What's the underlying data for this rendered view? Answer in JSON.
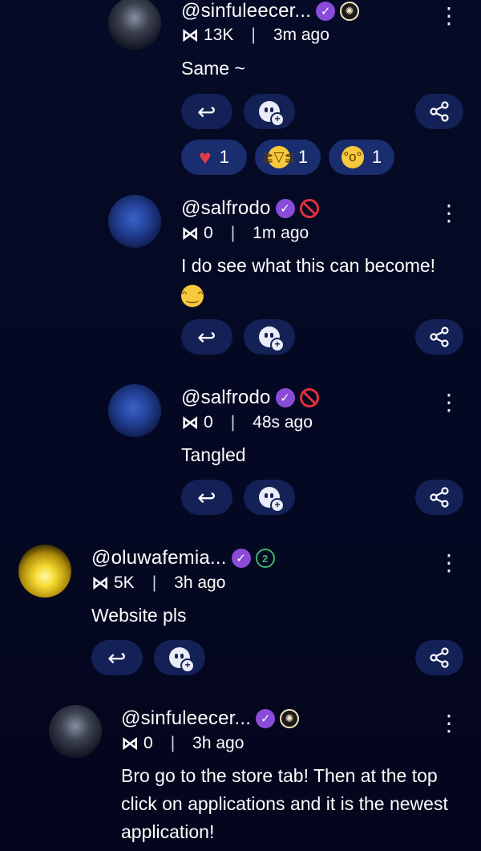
{
  "comments": [
    {
      "username": "@sinfuleecer...",
      "score": "13K",
      "time": "3m ago",
      "text": "Same ~",
      "reactions": [
        {
          "icon": "heart-emoji",
          "count": "1"
        },
        {
          "icon": "laughing-emoji",
          "count": "1"
        },
        {
          "icon": "surprised-emoji",
          "count": "1"
        }
      ]
    },
    {
      "username": "@salfrodo",
      "score": "0",
      "time": "1m ago",
      "text": "I do see what this can become!"
    },
    {
      "username": "@salfrodo",
      "score": "0",
      "time": "48s ago",
      "text": "Tangled"
    },
    {
      "username": "@oluwafemia...",
      "score": "5K",
      "time": "3h ago",
      "text": "Website pls",
      "level": "2"
    },
    {
      "username": "@sinfuleecer...",
      "score": "0",
      "time": "3h ago",
      "text": "Bro go to the store tab! Then at the top click on applications and it is the newest application!"
    }
  ],
  "colors": {
    "background": "#050a26",
    "button": "#142156",
    "verified_badge": "#8a4bd8",
    "ban": "#e0303b",
    "level_badge": "#3fb56a"
  }
}
